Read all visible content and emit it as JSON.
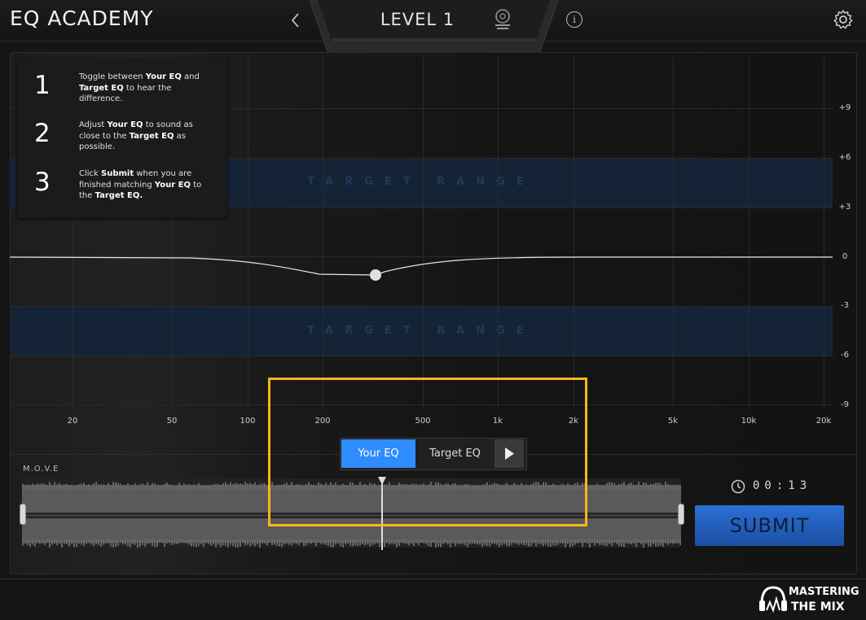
{
  "header": {
    "app_title": "EQ ACADEMY",
    "level_label": "LEVEL 1",
    "back_icon": "chevron-left-icon",
    "info_icon": "info-icon",
    "settings_icon": "gear-icon"
  },
  "eq_graph": {
    "db_labels": [
      "+9",
      "+6",
      "+3",
      "0",
      "-3",
      "-6",
      "-9"
    ],
    "freq_labels": [
      "20",
      "50",
      "100",
      "200",
      "500",
      "1k",
      "2k",
      "5k",
      "10k",
      "20k"
    ],
    "target_range_label": "TARGET RANGE",
    "eq_point": {
      "frequency_hz": 300,
      "gain_db": -0.7
    }
  },
  "instructions": [
    {
      "number": "1",
      "parts": [
        [
          "Toggle between ",
          false
        ],
        [
          "Your EQ",
          true
        ],
        [
          " and ",
          false
        ],
        [
          "Target EQ",
          true
        ],
        [
          " to hear the difference.",
          false
        ]
      ]
    },
    {
      "number": "2",
      "parts": [
        [
          "Adjust ",
          false
        ],
        [
          "Your EQ",
          true
        ],
        [
          " to sound as close to the ",
          false
        ],
        [
          "Target EQ",
          true
        ],
        [
          " as possible.",
          false
        ]
      ]
    },
    {
      "number": "3",
      "parts": [
        [
          "Click ",
          false
        ],
        [
          "Submit",
          true
        ],
        [
          " when you are finished matching ",
          false
        ],
        [
          "Your EQ",
          true
        ],
        [
          " to the ",
          false
        ],
        [
          "Target EQ.",
          true
        ]
      ]
    }
  ],
  "toggle": {
    "your_eq": "Your EQ",
    "target_eq": "Target EQ",
    "play_icon": "play-icon"
  },
  "track": {
    "name": "M.O.V.E",
    "timer": "00:13",
    "playhead_fraction": 0.546
  },
  "submit_label": "SUBMIT",
  "brand": {
    "top": "MASTERING",
    "bottom": "THE MIX"
  },
  "colors": {
    "accent": "#2f8cff",
    "highlight": "#f6b816",
    "target_band": "#152336",
    "submit": "#2360c0"
  }
}
